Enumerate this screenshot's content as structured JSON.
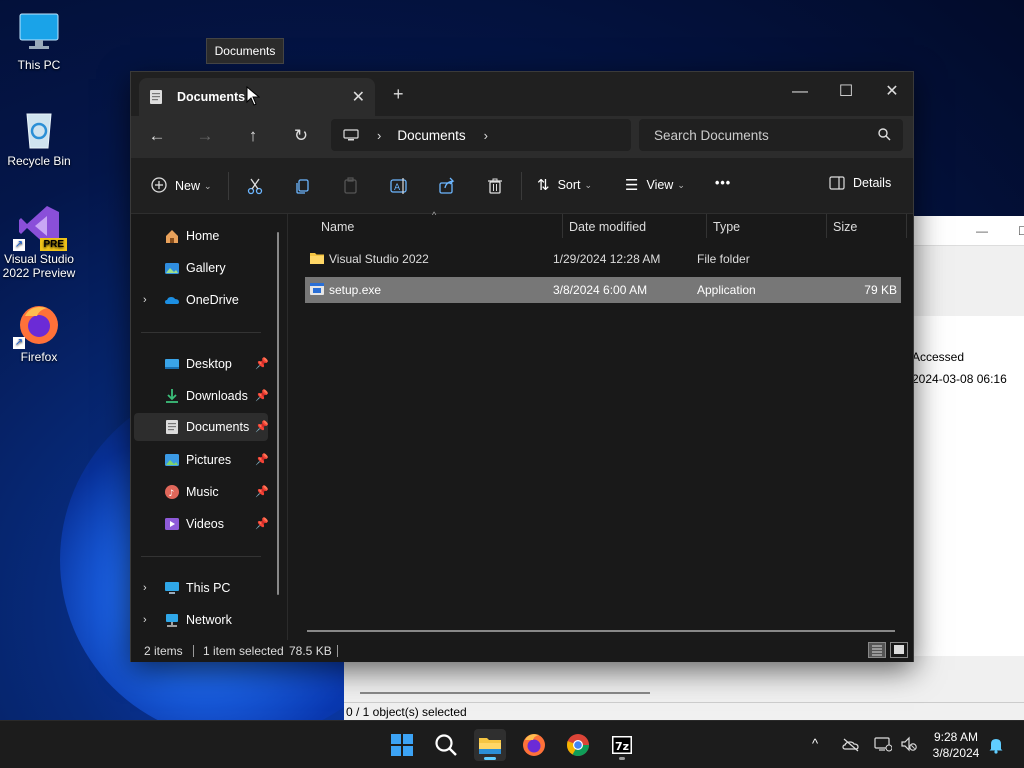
{
  "desktop": {
    "icons": [
      {
        "label": "This PC"
      },
      {
        "label": "Recycle Bin"
      },
      {
        "label": "Visual Studio 2022 Preview",
        "badge": "PRE"
      },
      {
        "label": "Firefox"
      }
    ]
  },
  "tooltip": {
    "text": "Documents"
  },
  "background_window": {
    "col_header": "Accessed",
    "value": "2024-03-08 06:16",
    "status": "0 / 1 object(s) selected"
  },
  "explorer": {
    "tab": {
      "title": "Documents",
      "close": "✕"
    },
    "new_tab": "+",
    "window_controls": {
      "minimize": "—",
      "maximize": "☐",
      "close": "✕"
    },
    "nav": {
      "back": "←",
      "forward": "→",
      "up": "↑",
      "refresh": "↻"
    },
    "path": {
      "crumb": "Documents"
    },
    "search": {
      "placeholder": "Search Documents"
    },
    "toolbar": {
      "new_label": "New",
      "sort_label": "Sort",
      "view_label": "View",
      "more_label": "•••",
      "details_label": "Details"
    },
    "sidebar": {
      "items": [
        {
          "label": "Home",
          "icon": "home-icon"
        },
        {
          "label": "Gallery",
          "icon": "gallery-icon"
        },
        {
          "label": "OneDrive",
          "icon": "onedrive-icon",
          "expand": "›"
        },
        {
          "label": "Desktop",
          "icon": "desktop-icon",
          "pinned": true
        },
        {
          "label": "Downloads",
          "icon": "downloads-icon",
          "pinned": true
        },
        {
          "label": "Documents",
          "icon": "documents-icon",
          "pinned": true,
          "selected": true
        },
        {
          "label": "Pictures",
          "icon": "pictures-icon",
          "pinned": true
        },
        {
          "label": "Music",
          "icon": "music-icon",
          "pinned": true
        },
        {
          "label": "Videos",
          "icon": "videos-icon",
          "pinned": true
        },
        {
          "label": "This PC",
          "icon": "this-pc-icon",
          "expand": "›"
        },
        {
          "label": "Network",
          "icon": "network-icon",
          "expand": "›"
        }
      ]
    },
    "columns": [
      "Name",
      "Date modified",
      "Type",
      "Size"
    ],
    "files": [
      {
        "name": "Visual Studio 2022",
        "date": "1/29/2024 12:28 AM",
        "type": "File folder",
        "size": "",
        "icon": "folder-icon",
        "selected": false
      },
      {
        "name": "setup.exe",
        "date": "3/8/2024 6:00 AM",
        "type": "Application",
        "size": "79 KB",
        "icon": "application-icon",
        "selected": true
      }
    ],
    "status": {
      "count": "2 items",
      "selection": "1 item selected",
      "size": "78.5 KB"
    }
  },
  "taskbar": {
    "clock_time": "9:28 AM",
    "clock_date": "3/8/2024",
    "tray_chevron": "^"
  },
  "colors": {
    "accent": "#60cdff",
    "selected_row": "#777777",
    "folder": "#f5c542"
  }
}
